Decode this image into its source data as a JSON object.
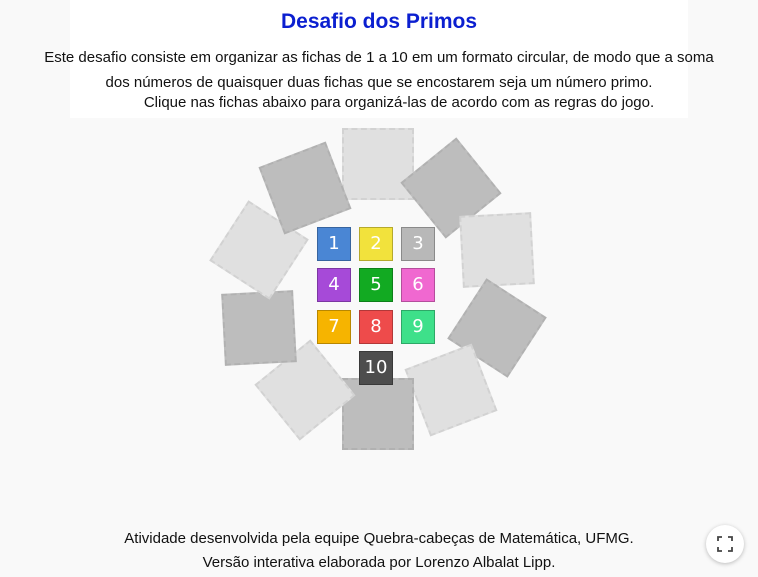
{
  "header": {
    "title": "Desafio dos Primos",
    "description": "Este desafio consiste em organizar as fichas de 1 a 10 em um formato circular, de modo que a soma dos números de quaisquer duas fichas que se encostarem seja um número primo.",
    "instruction": "Clique nas fichas abaixo para organizá-las de acordo com as regras do jogo."
  },
  "tiles": [
    {
      "label": "1",
      "color": "#4a86d4"
    },
    {
      "label": "2",
      "color": "#f2e23c"
    },
    {
      "label": "3",
      "color": "#b8b8b8"
    },
    {
      "label": "4",
      "color": "#a64ad8"
    },
    {
      "label": "5",
      "color": "#12aa22"
    },
    {
      "label": "6",
      "color": "#f068d0"
    },
    {
      "label": "7",
      "color": "#f6b400"
    },
    {
      "label": "8",
      "color": "#ee4b4b"
    },
    {
      "label": "9",
      "color": "#3ee08a"
    },
    {
      "label": "10",
      "color": "#4d4d4d"
    }
  ],
  "footer": {
    "line1": "Atividade desenvolvida pela equipe Quebra-cabeças de Matemática, UFMG.",
    "line2": "Versão interativa elaborada por Lorenzo Albalat Lipp."
  },
  "icons": {
    "fullscreen": "fullscreen-icon"
  }
}
